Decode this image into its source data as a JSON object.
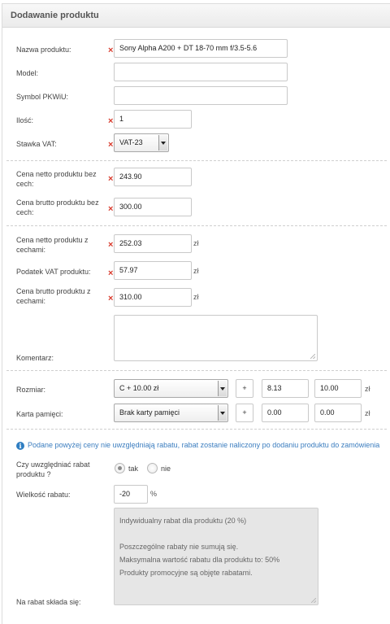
{
  "header": {
    "title": "Dodawanie produktu"
  },
  "product": {
    "name_label": "Nazwa produktu:",
    "name_value": "Sony Alpha A200 + DT 18-70 mm f/3.5-5.6",
    "model_label": "Model:",
    "model_value": "",
    "pkwiu_label": "Symbol PKWiU:",
    "pkwiu_value": "",
    "qty_label": "Ilość:",
    "qty_value": "1",
    "vat_label": "Stawka VAT:",
    "vat_value": "VAT-23"
  },
  "prices_base": {
    "net_label": "Cena netto produktu bez cech:",
    "net_value": "243.90",
    "gross_label": "Cena brutto produktu bez cech:",
    "gross_value": "300.00"
  },
  "prices_features": {
    "net_label": "Cena netto produktu z cechami:",
    "net_value": "252.03",
    "vat_label": "Podatek VAT produktu:",
    "vat_value": "57.97",
    "gross_label": "Cena brutto produktu z cechami:",
    "gross_value": "310.00",
    "currency": "zł"
  },
  "comment": {
    "label": "Komentarz:",
    "value": ""
  },
  "features": [
    {
      "label": "Rozmiar:",
      "option": "C + 10.00 zł",
      "sign": "+",
      "net": "8.13",
      "gross": "10.00",
      "currency": "zł"
    },
    {
      "label": "Karta pamięci:",
      "option": "Brak karty pamięci",
      "sign": "+",
      "net": "0.00",
      "gross": "0.00",
      "currency": "zł"
    }
  ],
  "notice": {
    "icon": "info-icon",
    "text": "Podane powyżej ceny nie uwzględniają rabatu, rabat zostanie naliczony po dodaniu produktu do zamówienia"
  },
  "discount": {
    "question_label": "Czy uwzględniać rabat produktu ?",
    "yes_label": "tak",
    "no_label": "nie",
    "selected": "tak",
    "amount_label": "Wielkość rabatu:",
    "amount_value": "-20",
    "amount_unit": "%",
    "breakdown_label": "Na rabat składa się:",
    "info_lines": [
      "Indywidualny rabat dla produktu (20 %)",
      "",
      "Poszczególne rabaty nie sumują się.",
      "Maksymalna wartość rabatu dla produktu to: 50%",
      "Produkty promocyjne są objęte rabatami."
    ]
  },
  "colors": {
    "required": "#d8392b",
    "notice": "#3b7dbf",
    "header_bg": "#ebebeb"
  }
}
